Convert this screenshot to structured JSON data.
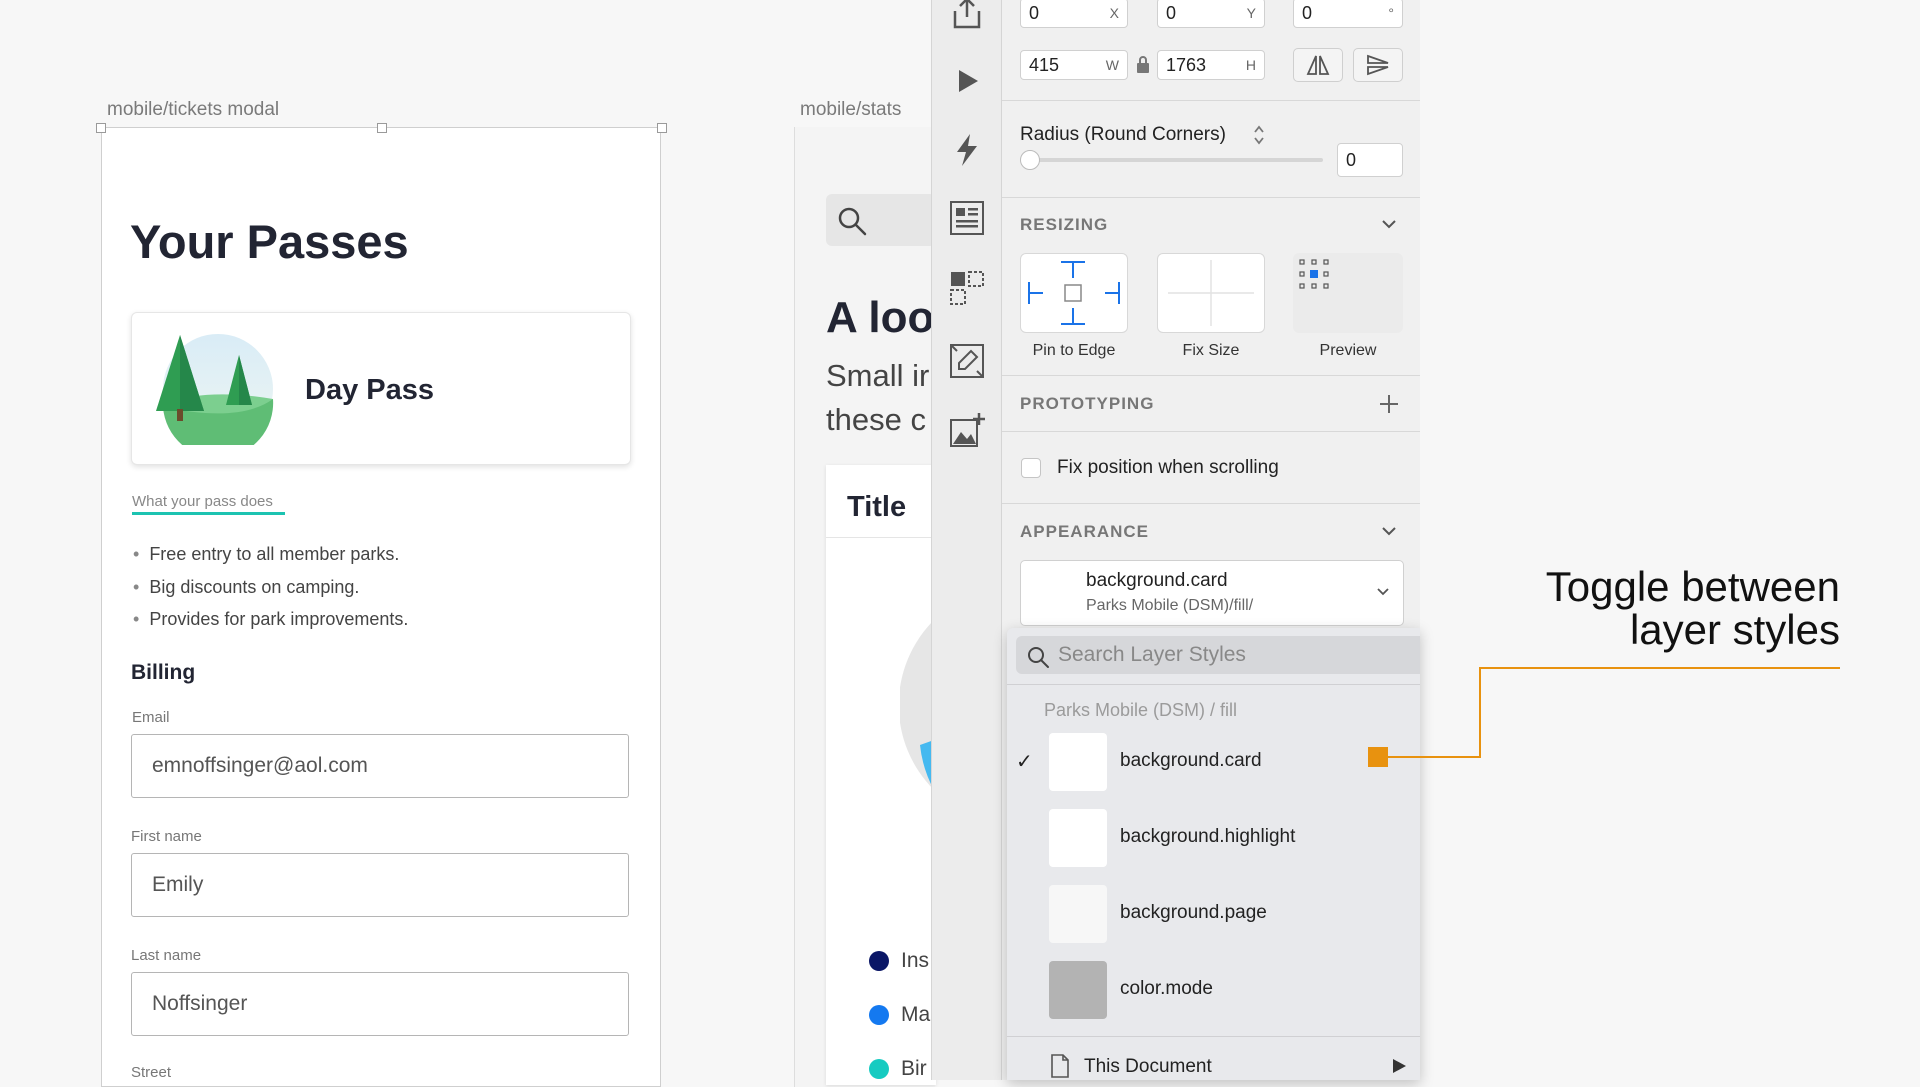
{
  "artboards": {
    "tickets_label": "mobile/tickets modal",
    "stats_label": "mobile/stats"
  },
  "tickets": {
    "title": "Your Passes",
    "day_pass": "Day Pass",
    "link": "What your pass does",
    "bullets": [
      "Free entry to all member parks.",
      "Big discounts on camping.",
      "Provides for park improvements."
    ],
    "billing": "Billing",
    "fields": [
      {
        "label": "Email",
        "value": "emnoffsinger@aol.com"
      },
      {
        "label": "First name",
        "value": "Emily"
      },
      {
        "label": "Last name",
        "value": "Noffsinger"
      },
      {
        "label": "Street",
        "value": ""
      }
    ]
  },
  "stats": {
    "heading": "A loo",
    "body_line1": "Small ir",
    "body_line2": "these c",
    "card_title": "Title",
    "legend": [
      {
        "label": "Ins",
        "color": "#0a1666"
      },
      {
        "label": "Ma",
        "color": "#1479f0"
      },
      {
        "label": "Bir",
        "color": "#16cbc1"
      }
    ],
    "pie_color": "#45b9f0"
  },
  "toolbar": {
    "icons": [
      "share-icon",
      "play-icon",
      "lightning-icon",
      "layout-icon",
      "symbol-icon",
      "edit-image-icon",
      "add-image-icon"
    ]
  },
  "inspector": {
    "x": {
      "value": "0",
      "suffix": "X"
    },
    "y": {
      "value": "0",
      "suffix": "Y"
    },
    "rotation": {
      "value": "0",
      "suffix": "°"
    },
    "w": {
      "value": "415",
      "suffix": "W"
    },
    "h": {
      "value": "1763",
      "suffix": "H"
    },
    "radius_label": "Radius (Round Corners)",
    "radius_value": "0",
    "resizing_title": "RESIZING",
    "resizing_options": [
      "Pin to Edge",
      "Fix Size",
      "Preview"
    ],
    "prototyping_title": "PROTOTYPING",
    "fix_position_label": "Fix position when scrolling",
    "appearance_title": "APPEARANCE",
    "appearance_style": "background.card",
    "appearance_path": "Parks Mobile (DSM)/fill/"
  },
  "dropdown": {
    "search_placeholder": "Search Layer Styles",
    "group": "Parks Mobile (DSM) / fill",
    "items": [
      {
        "label": "background.card",
        "checked": true,
        "swatch": "#ffffff"
      },
      {
        "label": "background.highlight",
        "checked": false,
        "swatch": "#ffffff"
      },
      {
        "label": "background.page",
        "checked": false,
        "swatch": "#f7f7f7"
      },
      {
        "label": "color.mode",
        "checked": false,
        "swatch": "#b3b3b3"
      }
    ],
    "check_mark": "✓",
    "footer": "This Document"
  },
  "annotation": {
    "line1": "Toggle between",
    "line2": "layer styles",
    "color": "#e8920f"
  }
}
